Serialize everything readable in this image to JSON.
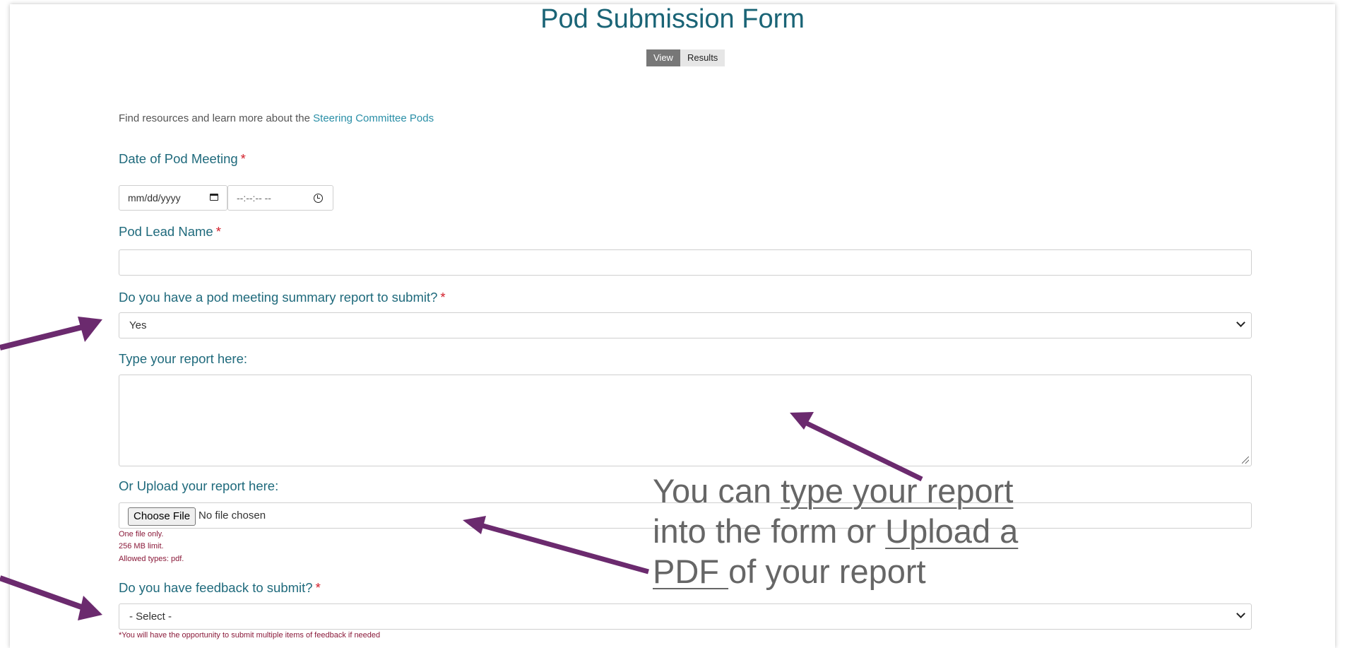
{
  "form": {
    "title": "Pod Submission Form",
    "tabs": {
      "view": "View",
      "results": "Results"
    },
    "intro": {
      "text": "Find resources and learn more about the ",
      "link": "Steering Committee Pods"
    },
    "date_label": "Date of Pod Meeting",
    "required_marker": "*",
    "date_placeholder": "mm/dd/yyyy",
    "time_placeholder": "--:--:-- --",
    "pod_lead_label": "Pod Lead Name",
    "pod_lead_value": "",
    "summary_question": "Do you have a pod meeting summary report to submit?",
    "summary_selected": "Yes",
    "type_report_label": "Type your report here:",
    "upload_label": "Or Upload your report here:",
    "choose_file_label": "Choose File",
    "no_file_text": "No file chosen",
    "upload_help": [
      "One file only.",
      "256 MB limit.",
      "Allowed types: pdf."
    ],
    "feedback_question": "Do you have feedback to submit?",
    "feedback_selected": "- Select -",
    "feedback_help": "*You will have the opportunity to submit multiple items of feedback if needed"
  },
  "annotation": {
    "text_1": "You can ",
    "underlined_1": "type your report",
    "text_2": " into the form or ",
    "underlined_2": "Upload a PDF ",
    "text_3": "of your report"
  },
  "colors": {
    "heading": "#1a6476",
    "label": "#1f6a7c",
    "link": "#2a8fa7",
    "required": "#d21f2a",
    "help": "#8a1a3a",
    "arrow": "#6b2a6e",
    "annotation": "#666666"
  }
}
